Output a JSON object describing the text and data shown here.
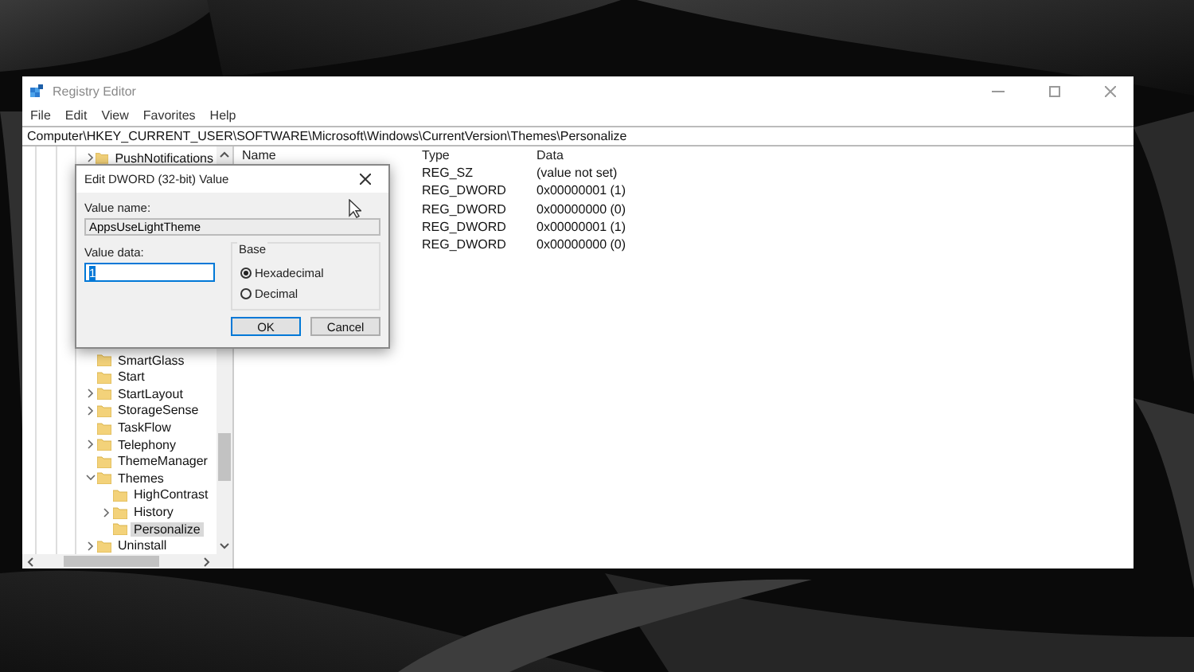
{
  "window": {
    "title": "Registry Editor",
    "active": false
  },
  "menu": [
    "File",
    "Edit",
    "View",
    "Favorites",
    "Help"
  ],
  "address": "Computer\\HKEY_CURRENT_USER\\SOFTWARE\\Microsoft\\Windows\\CurrentVersion\\Themes\\Personalize",
  "tree": {
    "items": [
      {
        "label": "PushNotifications",
        "expandable": true,
        "expanded": false,
        "selected": false
      },
      {
        "label": "SmartGlass",
        "expandable": false,
        "selected": false
      },
      {
        "label": "Start",
        "expandable": false,
        "selected": false
      },
      {
        "label": "StartLayout",
        "expandable": true,
        "expanded": false,
        "selected": false
      },
      {
        "label": "StorageSense",
        "expandable": true,
        "expanded": false,
        "selected": false
      },
      {
        "label": "TaskFlow",
        "expandable": false,
        "selected": false
      },
      {
        "label": "Telephony",
        "expandable": true,
        "expanded": false,
        "selected": false
      },
      {
        "label": "ThemeManager",
        "expandable": false,
        "selected": false
      },
      {
        "label": "Themes",
        "expandable": true,
        "expanded": true,
        "selected": false,
        "children": [
          {
            "label": "HighContrast",
            "expandable": false,
            "selected": false
          },
          {
            "label": "History",
            "expandable": true,
            "expanded": false,
            "selected": false
          },
          {
            "label": "Personalize",
            "expandable": false,
            "selected": true
          }
        ]
      },
      {
        "label": "Uninstall",
        "expandable": true,
        "expanded": false,
        "selected": false
      }
    ]
  },
  "list": {
    "columns": [
      "Name",
      "Type",
      "Data"
    ],
    "rows": [
      {
        "type": "REG_SZ",
        "data": "(value not set)"
      },
      {
        "type": "REG_DWORD",
        "data": "0x00000001 (1)"
      },
      {
        "type": "REG_DWORD",
        "data": "0x00000000 (0)"
      },
      {
        "type": "REG_DWORD",
        "data": "0x00000001 (1)"
      },
      {
        "type": "REG_DWORD",
        "data": "0x00000000 (0)"
      }
    ]
  },
  "dialog": {
    "title": "Edit DWORD (32-bit) Value",
    "value_name_label": "Value name:",
    "value_name": "AppsUseLightTheme",
    "value_data_label": "Value data:",
    "value_data": "1",
    "base_label": "Base",
    "radios": [
      {
        "label": "Hexadecimal",
        "selected": true
      },
      {
        "label": "Decimal",
        "selected": false
      }
    ],
    "buttons": [
      {
        "label": "OK",
        "default": true
      },
      {
        "label": "Cancel",
        "default": false
      }
    ]
  }
}
